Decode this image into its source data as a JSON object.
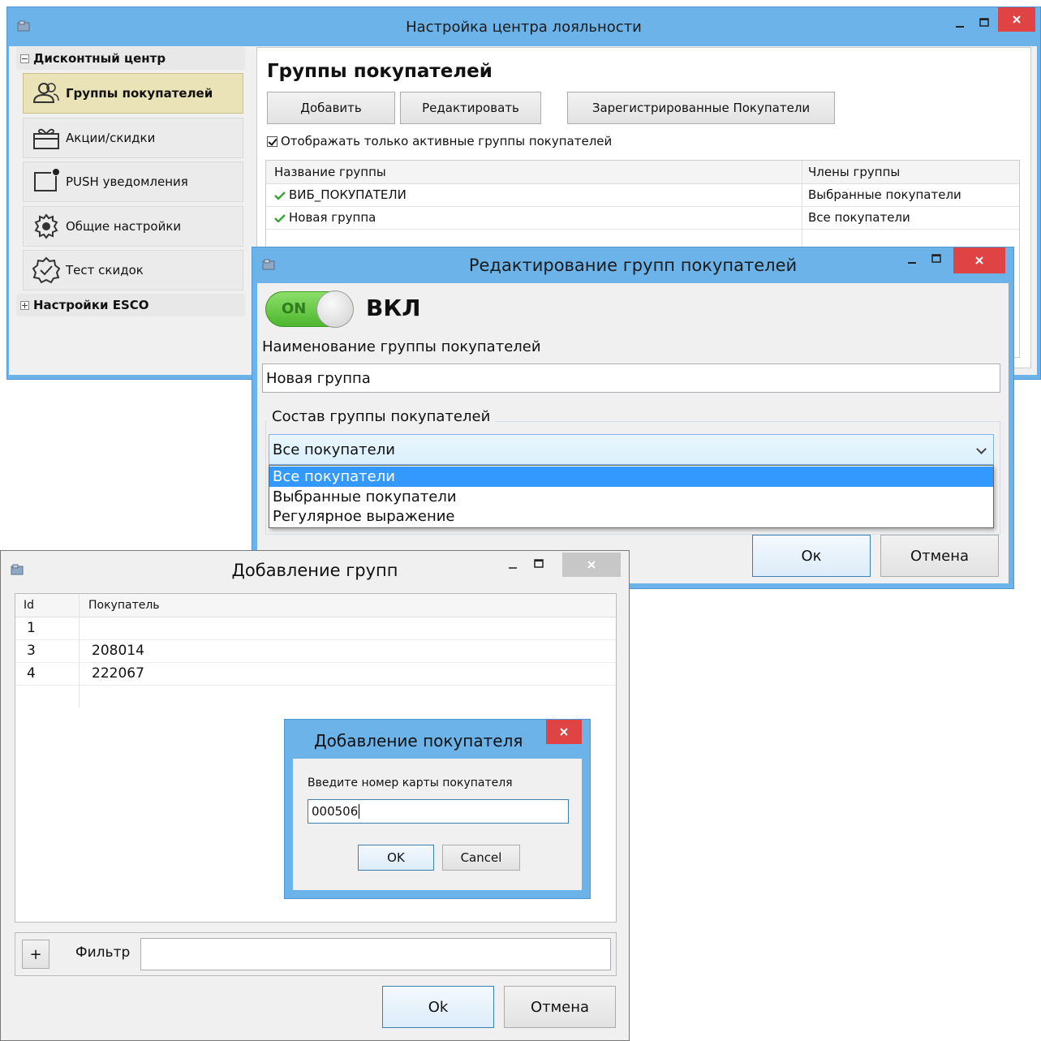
{
  "colors": {
    "accent": "#6bb3e8",
    "close": "#e04343",
    "selection": "#3399ff",
    "toggle_on": "#4cb52d"
  },
  "main_window": {
    "title": "Настройка центра лояльности",
    "sidebar": {
      "root1": "Дисконтный центр",
      "items": [
        {
          "label": "Группы покупателей",
          "icon": "users-icon"
        },
        {
          "label": "Акции/скидки",
          "icon": "gift-icon"
        },
        {
          "label": "PUSH уведомления",
          "icon": "notification-icon"
        },
        {
          "label": "Общие настройки",
          "icon": "gear-icon"
        },
        {
          "label": "Тест скидок",
          "icon": "badge-check-icon"
        }
      ],
      "root2": "Настройки ESCO"
    },
    "page_title": "Группы покупателей",
    "buttons": {
      "add": "Добавить",
      "edit": "Редактировать",
      "registered": "Зарегистрированные Покупатели"
    },
    "checkbox_label": "Отображать только активные группы покупателей",
    "table": {
      "col_name": "Название группы",
      "col_members": "Члены группы",
      "rows": [
        {
          "name": "ВИБ_ПОКУПАТЕЛИ",
          "members": "Выбранные покупатели"
        },
        {
          "name": "Новая группа",
          "members": "Все покупатели"
        }
      ]
    }
  },
  "edit_dialog": {
    "title": "Редактирование групп покупателей",
    "toggle_text": "ON",
    "status": "ВКЛ",
    "name_label": "Наименование группы покупателей",
    "name_value": "Новая группа",
    "composition_label": "Состав группы покупателей",
    "combo_value": "Все покупатели",
    "options": [
      "Все покупатели",
      "Выбранные покупатели",
      "Регулярное выражение"
    ],
    "ok": "Ок",
    "cancel": "Отмена"
  },
  "add_groups_dialog": {
    "title": "Добавление групп",
    "col_id": "Id",
    "col_customer": "Покупатель",
    "rows": [
      {
        "id": "1",
        "customer": ""
      },
      {
        "id": "3",
        "customer": "208014"
      },
      {
        "id": "4",
        "customer": "222067"
      }
    ],
    "plus": "+",
    "filter_label": "Фильтр",
    "filter_value": "",
    "ok": "Ok",
    "cancel": "Отмена"
  },
  "add_customer_dialog": {
    "title": "Добавление покупателя",
    "prompt": "Введите номер карты покупателя",
    "value": "000506",
    "ok": "OK",
    "cancel": "Cancel"
  }
}
